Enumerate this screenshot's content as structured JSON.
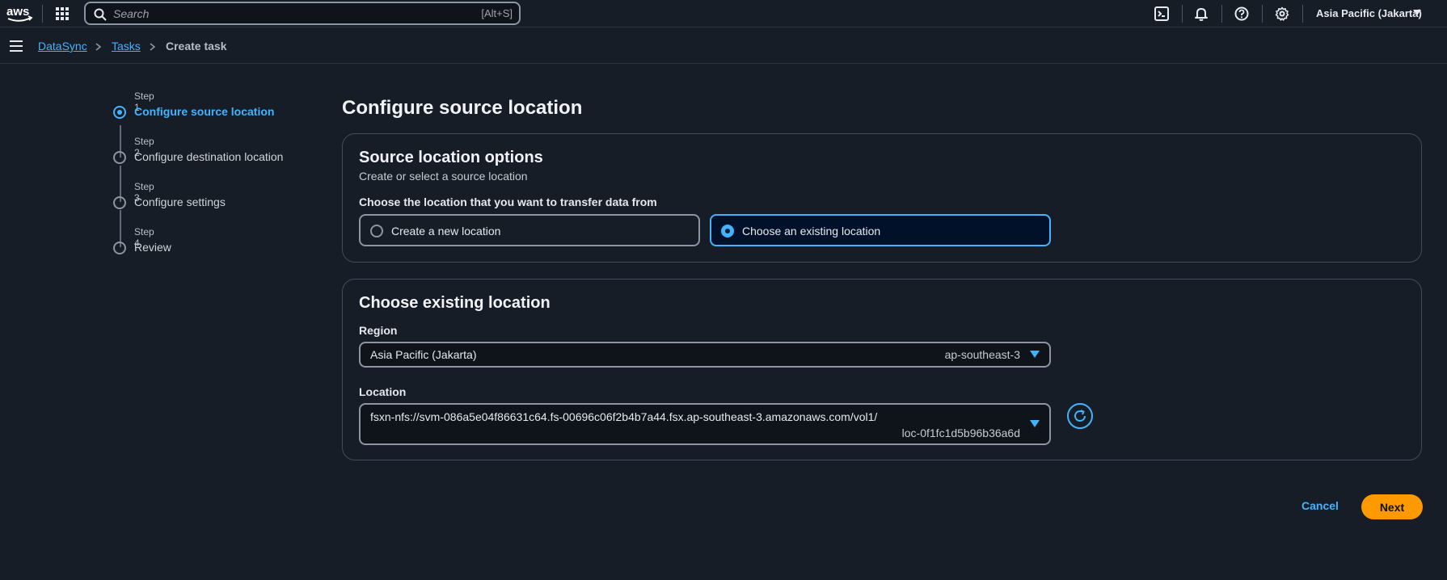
{
  "topnav": {
    "logo_text": "aws",
    "search_placeholder": "Search",
    "search_shortcut": "[Alt+S]",
    "region": "Asia Pacific (Jakarta)"
  },
  "breadcrumb": {
    "items": [
      "DataSync",
      "Tasks",
      "Create task"
    ]
  },
  "steps": [
    {
      "num": "Step 1",
      "title": "Configure source location",
      "active": true
    },
    {
      "num": "Step 2",
      "title": "Configure destination location",
      "active": false
    },
    {
      "num": "Step 3",
      "title": "Configure settings",
      "active": false
    },
    {
      "num": "Step 4",
      "title": "Review",
      "active": false
    }
  ],
  "page_title": "Configure source location",
  "source_options": {
    "title": "Source location options",
    "description": "Create or select a source location",
    "question": "Choose the location that you want to transfer data from",
    "options": [
      {
        "label": "Create a new location",
        "selected": false
      },
      {
        "label": "Choose an existing location",
        "selected": true
      }
    ]
  },
  "existing_location": {
    "title": "Choose existing location",
    "region_label": "Region",
    "region_value": "Asia Pacific (Jakarta)",
    "region_code": "ap-southeast-3",
    "location_label": "Location",
    "location_value": "fsxn-nfs://svm-086a5e04f86631c64.fs-00696c06f2b4b7a44.fsx.ap-southeast-3.amazonaws.com/vol1/",
    "location_id": "loc-0f1fc1d5b96b36a6d"
  },
  "actions": {
    "cancel": "Cancel",
    "next": "Next"
  },
  "colors": {
    "accent": "#42b4ff",
    "primary_button": "#ff9900",
    "background": "#161d26"
  }
}
